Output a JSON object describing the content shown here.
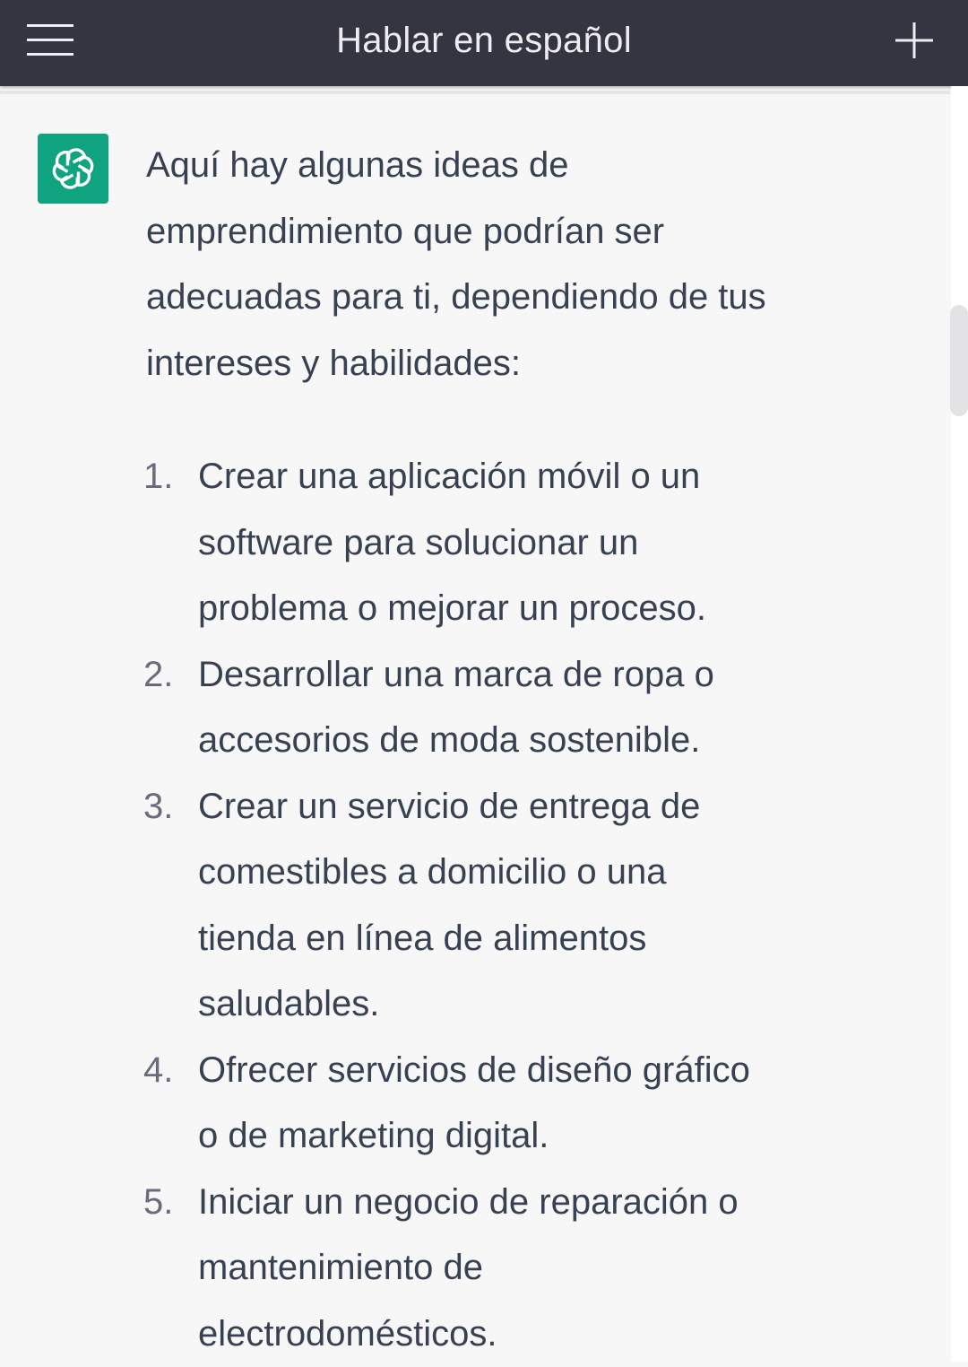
{
  "header": {
    "title": "Hablar en español",
    "menu_icon": "hamburger-icon",
    "new_chat_icon": "plus-icon"
  },
  "message": {
    "avatar_icon": "openai-logo-icon",
    "intro": "Aquí hay algunas ideas de emprendimiento que podrían ser adecuadas para ti, dependiendo de tus intereses y habilidades:",
    "items": [
      {
        "num": "1.",
        "text": "Crear una aplicación móvil o un software para solucionar un problema o mejorar un proceso."
      },
      {
        "num": "2.",
        "text": "Desarrollar una marca de ropa o accesorios de moda sostenible."
      },
      {
        "num": "3.",
        "text": "Crear un servicio de entrega de comestibles a domicilio o una tienda en línea de alimentos saludables."
      },
      {
        "num": "4.",
        "text": "Ofrecer servicios de diseño gráfico o de marketing digital."
      },
      {
        "num": "5.",
        "text": "Iniciar un negocio de reparación o mantenimiento de electrodomésticos."
      }
    ]
  },
  "colors": {
    "header_bg": "#343541",
    "avatar_bg": "#10a37f",
    "text": "#374151",
    "page_bg": "#f7f7f8"
  }
}
